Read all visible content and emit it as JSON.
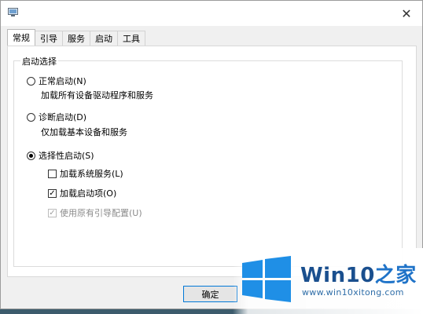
{
  "window": {
    "title": ""
  },
  "tabs": [
    {
      "label": "常规",
      "active": true
    },
    {
      "label": "引导",
      "active": false
    },
    {
      "label": "服务",
      "active": false
    },
    {
      "label": "启动",
      "active": false
    },
    {
      "label": "工具",
      "active": false
    }
  ],
  "startup_selection": {
    "group_title": "启动选择",
    "normal": {
      "label": "正常启动(N)",
      "description": "加载所有设备驱动程序和服务",
      "checked": false
    },
    "diagnostic": {
      "label": "诊断启动(D)",
      "description": "仅加载基本设备和服务",
      "checked": false
    },
    "selective": {
      "label": "选择性启动(S)",
      "checked": true,
      "options": [
        {
          "label": "加载系统服务(L)",
          "checked": false,
          "disabled": false
        },
        {
          "label": "加载启动项(O)",
          "checked": true,
          "disabled": false
        },
        {
          "label": "使用原有引导配置(U)",
          "checked": true,
          "disabled": true
        }
      ]
    }
  },
  "buttons": {
    "ok": "确定"
  },
  "watermark": {
    "brand": "Win10",
    "brand_suffix": "之家",
    "url": "www.win10xitong.com"
  },
  "colors": {
    "accent": "#0078d7",
    "watermark_blue": "#1f73c8"
  }
}
